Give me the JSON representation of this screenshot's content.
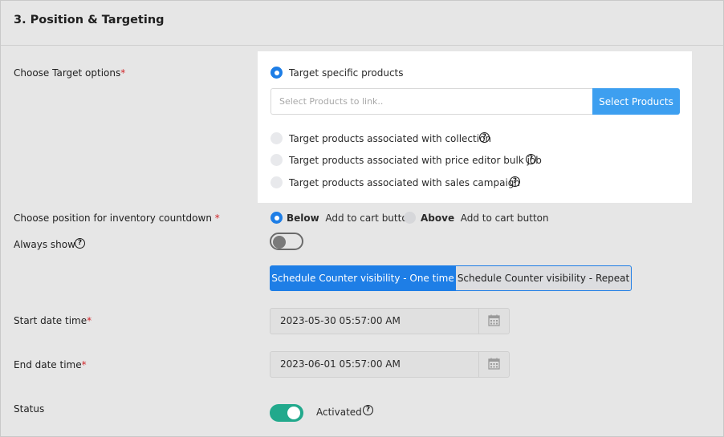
{
  "section": {
    "title": "3. Position & Targeting"
  },
  "target": {
    "label": "Choose Target options",
    "required_mark": "*",
    "options": [
      {
        "label": "Target specific products",
        "selected": true
      },
      {
        "label": "Target products associated with collection",
        "selected": false
      },
      {
        "label": "Target products associated with price editor bulk job",
        "selected": false
      },
      {
        "label": "Target products associated with sales campaign",
        "selected": false
      }
    ],
    "product_input_placeholder": "Select Products to link..",
    "select_button": "Select Products"
  },
  "position": {
    "label": "Choose position for inventory countdown",
    "required_mark": "*",
    "below_bold": "Below",
    "below_rest": "Add to cart button",
    "above_bold": "Above",
    "above_rest": "Add to cart button",
    "selected": "Below"
  },
  "always_show": {
    "label": "Always show",
    "enabled": false
  },
  "schedule": {
    "one_time": "Schedule Counter visibility - One time",
    "repeat": "Schedule Counter visibility - Repeat",
    "active": "one_time"
  },
  "start": {
    "label": "Start date time",
    "required_mark": "*",
    "value": "2023-05-30 05:57:00 AM"
  },
  "end": {
    "label": "End date time",
    "required_mark": "*",
    "value": "2023-06-01 05:57:00 AM"
  },
  "status": {
    "label": "Status",
    "state_text": "Activated",
    "enabled": true
  },
  "icons": {
    "help": "question-circle-icon",
    "calendar": "calendar-icon"
  },
  "colors": {
    "primary": "#1e7ee6",
    "select_button": "#3d9ff0",
    "toggle_on": "#22a98c",
    "required": "#d0262a"
  }
}
